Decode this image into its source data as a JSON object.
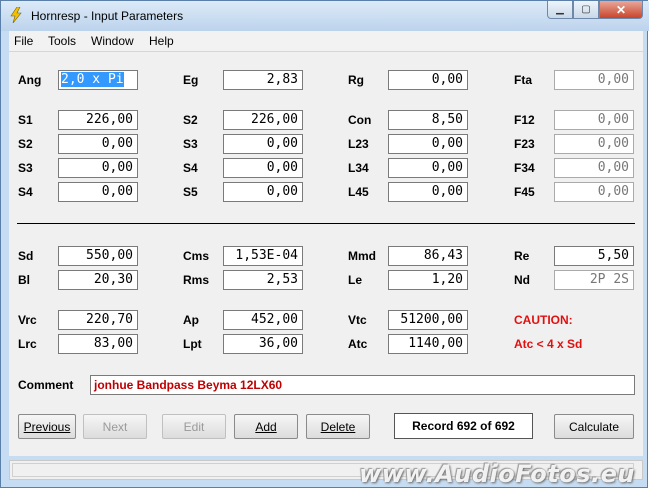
{
  "window": {
    "title": "Hornresp - Input Parameters"
  },
  "menu": [
    "File",
    "Tools",
    "Window",
    "Help"
  ],
  "params": {
    "Ang": "2,0 x Pi",
    "Eg": "2,83",
    "Rg": "0,00",
    "Fta": "0,00",
    "S1": "226,00",
    "S2": "226,00",
    "Con": "8,50",
    "F12": "0,00",
    "S2b": "0,00",
    "S3": "0,00",
    "L23": "0,00",
    "F23": "0,00",
    "S3b": "0,00",
    "S4": "0,00",
    "L34": "0,00",
    "F34": "0,00",
    "S4b": "0,00",
    "S5": "0,00",
    "L45": "0,00",
    "F45": "0,00",
    "Sd": "550,00",
    "Cms": "1,53E-04",
    "Mmd": "86,43",
    "Re": "5,50",
    "Bl": "20,30",
    "Rms": "2,53",
    "Le": "1,20",
    "Nd": "2P 2S",
    "Vrc": "220,70",
    "Ap": "452,00",
    "Vtc": "51200,00",
    "Lrc": "83,00",
    "Lpt": "36,00",
    "Atc": "1140,00"
  },
  "labels": {
    "Ang": "Ang",
    "Eg": "Eg",
    "Rg": "Rg",
    "Fta": "Fta",
    "S1": "S1",
    "S2": "S2",
    "Con": "Con",
    "F12": "F12",
    "S2b": "S2",
    "S3": "S3",
    "L23": "L23",
    "F23": "F23",
    "S3b": "S3",
    "S4": "S4",
    "L34": "L34",
    "F34": "F34",
    "S4b": "S4",
    "S5": "S5",
    "L45": "L45",
    "F45": "F45",
    "Sd": "Sd",
    "Cms": "Cms",
    "Mmd": "Mmd",
    "Re": "Re",
    "Bl": "Bl",
    "Rms": "Rms",
    "Le": "Le",
    "Nd": "Nd",
    "Vrc": "Vrc",
    "Ap": "Ap",
    "Vtc": "Vtc",
    "Lrc": "Lrc",
    "Lpt": "Lpt",
    "Atc": "Atc"
  },
  "warning": {
    "title": "CAUTION:",
    "message": "Atc < 4 x Sd",
    "color": "#e01010"
  },
  "comment": {
    "label": "Comment",
    "value": "jonhue Bandpass Beyma 12LX60"
  },
  "buttons": {
    "previous": "Previous",
    "next": "Next",
    "edit": "Edit",
    "add": "Add",
    "delete": "Delete",
    "calculate": "Calculate"
  },
  "record": "Record 692 of 692",
  "watermark": "www.AudioFotos.eu",
  "icons": {
    "app": "lightning-bolt-icon",
    "minimize": "minimize-icon",
    "maximize": "maximize-icon",
    "close": "close-icon"
  }
}
